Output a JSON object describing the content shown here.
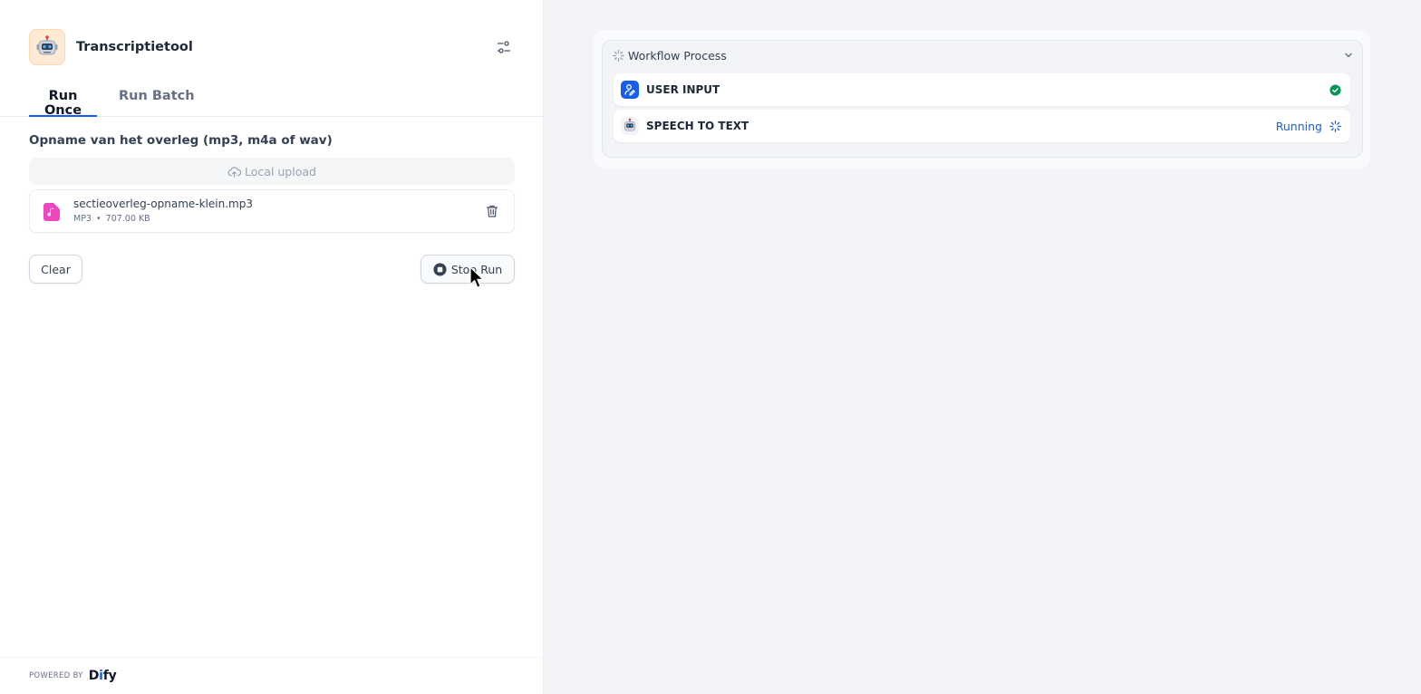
{
  "app": {
    "title": "Transcriptietool",
    "icon": "robot-emoji"
  },
  "tabs": [
    {
      "label": "Run Once",
      "active": true
    },
    {
      "label": "Run Batch",
      "active": false
    }
  ],
  "form": {
    "field_label": "Opname van het overleg (mp3, m4a of wav)",
    "upload_label": "Local upload",
    "file": {
      "name": "sectieoverleg-opname-klein.mp3",
      "type": "MP3",
      "separator": "•",
      "size": "707.00 KB"
    },
    "clear_label": "Clear",
    "stop_label": "Stop Run"
  },
  "footer": {
    "powered_by": "POWERED BY",
    "brand": {
      "d": "D",
      "i": "i",
      "fy": "fy"
    }
  },
  "workflow": {
    "title": "Workflow Process",
    "nodes": [
      {
        "title": "USER INPUT",
        "status": "success"
      },
      {
        "title": "SPEECH TO TEXT",
        "status_label": "Running"
      }
    ]
  },
  "colors": {
    "accent": "#155eef",
    "success": "#079455",
    "file_icon": "#ee46bc"
  }
}
